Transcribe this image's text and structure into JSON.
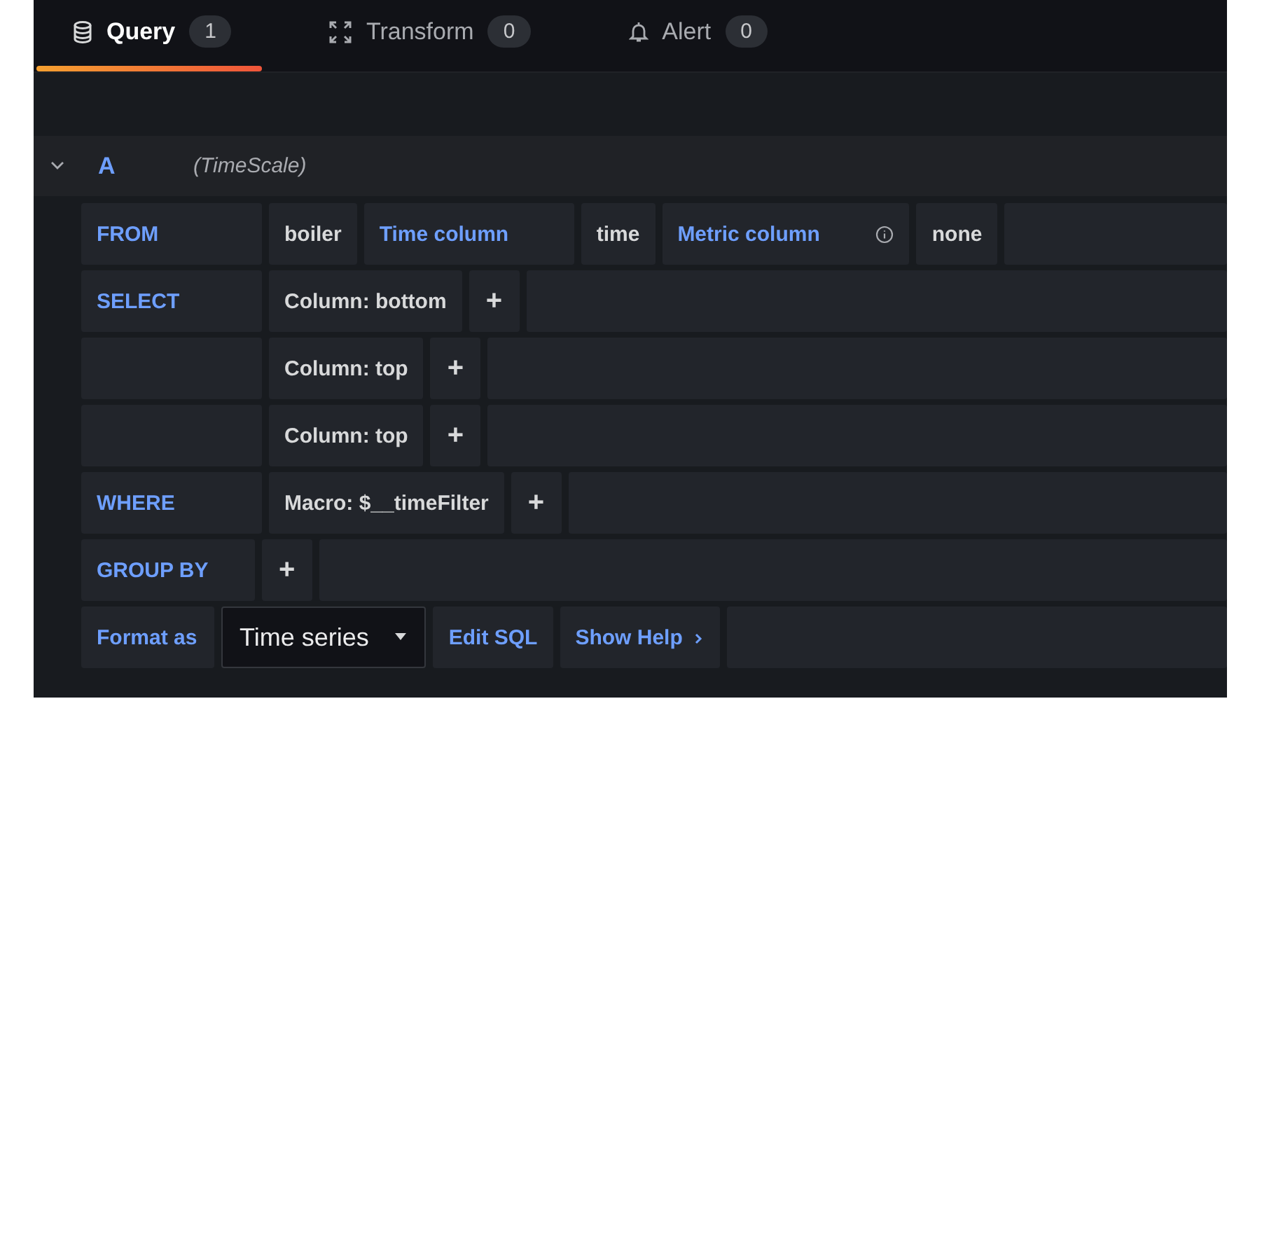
{
  "tabs": [
    {
      "label": "Query",
      "kind": "database",
      "count": "1",
      "selected": true
    },
    {
      "label": "Transform",
      "kind": "transform",
      "count": "0",
      "selected": false
    },
    {
      "label": "Alert",
      "kind": "alert",
      "count": "0",
      "selected": false
    }
  ],
  "query": {
    "name": "A",
    "expanded": true,
    "datasource": "(TimeScale)"
  },
  "rows": [
    {
      "label": "FROM",
      "parts": [
        {
          "kind": "value",
          "text": "boiler"
        },
        {
          "kind": "keyword",
          "text": "Time column"
        },
        {
          "kind": "value",
          "text": "time"
        },
        {
          "kind": "keyword",
          "text": "Metric column",
          "info": true
        },
        {
          "kind": "value",
          "text": "none"
        }
      ]
    },
    {
      "label": "SELECT",
      "parts": [
        {
          "kind": "value",
          "text": "Column: bottom"
        },
        {
          "kind": "add",
          "text": "+"
        }
      ]
    },
    {
      "label": "",
      "parts": [
        {
          "kind": "value",
          "text": "Column: top"
        },
        {
          "kind": "add",
          "text": "+"
        }
      ]
    },
    {
      "label": "",
      "parts": [
        {
          "kind": "value",
          "text": "Column: top"
        },
        {
          "kind": "add",
          "text": "+"
        }
      ]
    },
    {
      "label": "WHERE",
      "parts": [
        {
          "kind": "value",
          "text": "Macro: $__timeFilter"
        },
        {
          "kind": "add",
          "text": "+"
        }
      ]
    },
    {
      "label": "GROUP BY",
      "parts": [
        {
          "kind": "add",
          "text": "+"
        }
      ]
    },
    {
      "label": "Format as",
      "parts": [
        {
          "kind": "dropdown",
          "text": "Time series"
        },
        {
          "kind": "button",
          "text": "Edit SQL"
        },
        {
          "kind": "toggle",
          "text": "Show Help",
          "expanded": false
        }
      ]
    }
  ]
}
